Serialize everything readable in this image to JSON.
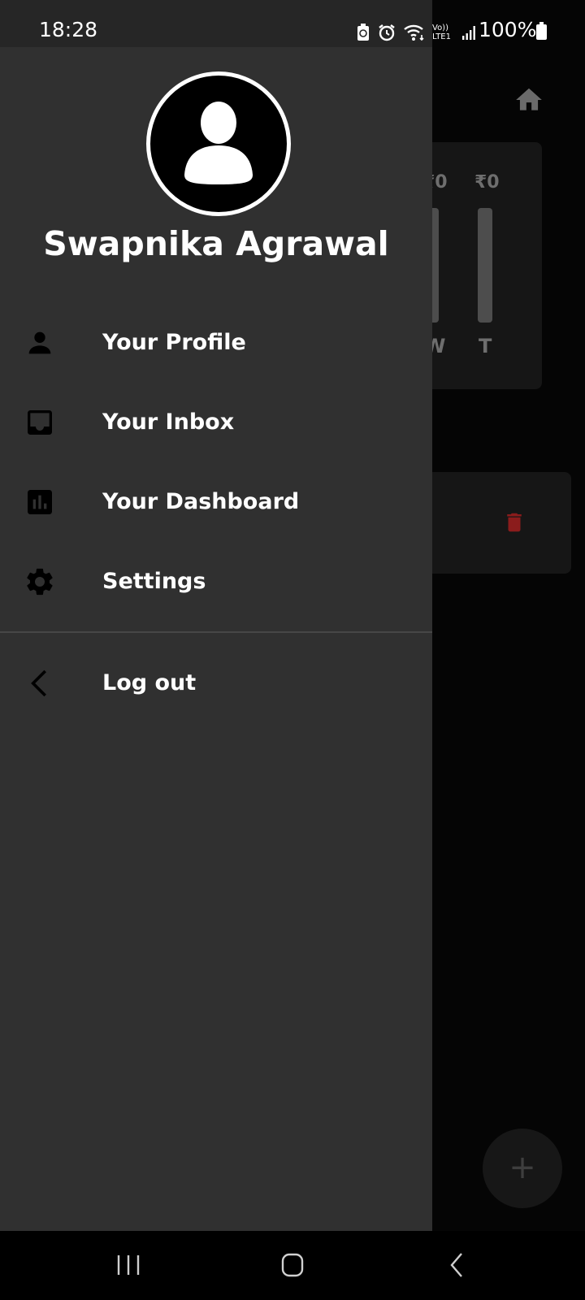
{
  "status_bar": {
    "time": "18:28",
    "battery": "100%",
    "network": "Vo)) LTE1"
  },
  "background": {
    "values": [
      "₹0",
      "₹0"
    ],
    "days": [
      "W",
      "T"
    ],
    "fab_label": "+"
  },
  "drawer": {
    "user_name": "Swapnika Agrawal",
    "items": [
      {
        "label": "Your Profile",
        "icon": "person-icon"
      },
      {
        "label": "Your Inbox",
        "icon": "inbox-icon"
      },
      {
        "label": "Your Dashboard",
        "icon": "bar-chart-icon"
      },
      {
        "label": "Settings",
        "icon": "gear-icon"
      }
    ],
    "logout": {
      "label": "Log out",
      "icon": "chevron-left-icon"
    }
  },
  "colors": {
    "drawer_bg": "#303030",
    "accent_delete": "#8b1c1c"
  }
}
